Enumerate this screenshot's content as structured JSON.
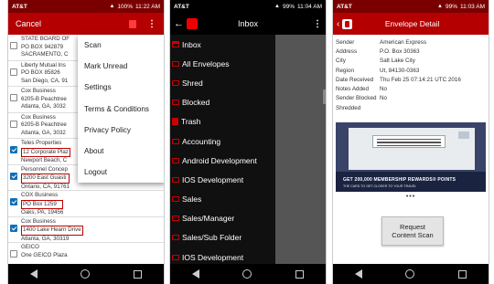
{
  "phone1": {
    "status": {
      "carrier": "AT&T",
      "battery": "100%",
      "time": "11:22 AM"
    },
    "appbar": {
      "cancel_label": "Cancel",
      "trash_icon": "trash-icon",
      "kebab": "⋮"
    },
    "mail_items": [
      {
        "lines": [
          "STATE BOARD OF",
          "PO BOX 942879",
          "SACRAMENTO, C"
        ],
        "checked": false
      },
      {
        "lines": [
          "Liberty Mutual Ins",
          "PO BOX 85826",
          "San Diego, CA, 91"
        ],
        "checked": false
      },
      {
        "lines": [
          "Cox Business",
          "6205-B Peachtree",
          "Atlanta, GA, 3032"
        ],
        "checked": false
      },
      {
        "lines": [
          "Cox Business",
          "6205-B Peachtree",
          "Atlanta, GA, 3032"
        ],
        "checked": false
      },
      {
        "lines": [
          "Teles Properties",
          "12 Corporate Plaz",
          "Newport Beach, C"
        ],
        "checked": true
      },
      {
        "lines": [
          "Personnel Concep",
          "3200 East Guasti",
          "Ontario, CA, 91761"
        ],
        "checked": true
      },
      {
        "lines": [
          "COX Business",
          "PO Box 1259",
          "Oaks, PA, 19456"
        ],
        "checked": true
      },
      {
        "lines": [
          "Cox Business",
          "1400 Lake Hearn Drive",
          "Atlanta, GA, 30319"
        ],
        "checked": true
      },
      {
        "lines": [
          "GEICO",
          "One GEICO Plaza",
          ""
        ],
        "checked": false
      }
    ],
    "menu": [
      "Scan",
      "Mark Unread",
      "Settings",
      "Terms & Conditions",
      "Privacy Policy",
      "About",
      "Logout"
    ]
  },
  "phone2": {
    "status": {
      "carrier": "AT&T",
      "battery": "99%",
      "time": "11:04 AM"
    },
    "appbar": {
      "back": "←",
      "title": "Inbox",
      "kebab": "⋮"
    },
    "drawer_items": [
      {
        "label": "Inbox",
        "icon": "inbox-icon"
      },
      {
        "label": "All Envelopes",
        "icon": "folder-icon"
      },
      {
        "label": "Shred",
        "icon": "folder-icon"
      },
      {
        "label": "Blocked",
        "icon": "folder-icon"
      },
      {
        "label": "Trash",
        "icon": "trash-icon"
      },
      {
        "label": "Accounting",
        "icon": "folder-icon"
      },
      {
        "label": "Android Development",
        "icon": "folder-icon"
      },
      {
        "label": "IOS Development",
        "icon": "folder-icon"
      },
      {
        "label": "Sales",
        "icon": "folder-icon"
      },
      {
        "label": "Sales/Manager",
        "icon": "folder-icon"
      },
      {
        "label": "Sales/Sub Folder",
        "icon": "folder-icon"
      },
      {
        "label": "IOS Development",
        "icon": "folder-icon"
      }
    ]
  },
  "phone3": {
    "status": {
      "carrier": "AT&T",
      "battery": "99%",
      "time": "11:03 AM"
    },
    "appbar": {
      "back": "‹",
      "title": "Envelope Detail"
    },
    "details": [
      {
        "label": "Sender",
        "value": "American Express"
      },
      {
        "label": "Address",
        "value": "P.O. Box 30363"
      },
      {
        "label": "City",
        "value": "Salt Lake City"
      },
      {
        "label": "Region",
        "value": "Ut, 84130-0363"
      },
      {
        "label": "Date Received",
        "value": "Thu Feb 25 07:14:21 UTC 2016"
      },
      {
        "label": "Notes Added",
        "value": "No"
      },
      {
        "label": "Sender Blocked",
        "value": "No"
      },
      {
        "label": "Shredded",
        "value": ""
      }
    ],
    "envelope_promo": "GET 200,000 MEMBERSHIP REWARDS® POINTS",
    "envelope_promo2": "THE CARD TO GET CLOSER TO YOUR TRAVEL",
    "pager_dots": "•••",
    "button_line1": "Request",
    "button_line2": "Content Scan"
  },
  "colors": {
    "brand_red": "#b40000",
    "dark_red": "#7a0000",
    "check_blue": "#0d6fb8"
  }
}
